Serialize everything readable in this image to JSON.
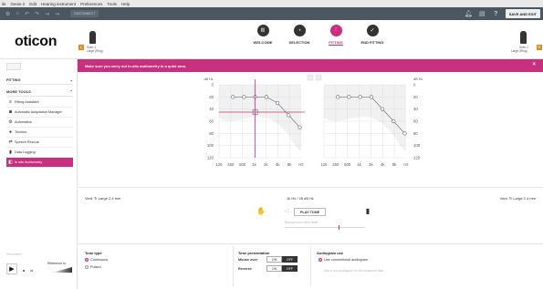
{
  "menubar": {
    "items": [
      "ile",
      "Genie 2",
      "Edit",
      "Hearing instrument",
      "Preferences",
      "Tools",
      "Help"
    ]
  },
  "toolbar": {
    "connect_label": "DISCONNECT",
    "save_exit_label": "SAVE AND EXIT"
  },
  "header": {
    "logo": "oticon",
    "device_left": {
      "tag": "L",
      "name": "Siren 1",
      "size": "Large (Ring)"
    },
    "device_right": {
      "tag": "R",
      "name": "Siren 1",
      "size": "Large (Ring)"
    },
    "nav": [
      {
        "label": "WELCOME",
        "icon": "welcome-icon"
      },
      {
        "label": "SELECTION",
        "icon": "selection-icon"
      },
      {
        "label": "FITTING",
        "icon": "fitting-icon",
        "active": true
      },
      {
        "label": "END FITTING",
        "icon": "end-fitting-icon"
      }
    ]
  },
  "sidebar": {
    "fitting_label": "FITTING",
    "more_tools_label": "MORE TOOLS",
    "items": [
      {
        "label": "Fitting Assistant",
        "icon": "fitting-assistant-icon"
      },
      {
        "label": "Automatic Adaptation Manager",
        "icon": "adaptation-manager-icon"
      },
      {
        "label": "Automatics",
        "icon": "automatics-icon"
      },
      {
        "label": "Tinnitus",
        "icon": "tinnitus-icon"
      },
      {
        "label": "Speech Rescue",
        "icon": "speech-rescue-icon"
      },
      {
        "label": "Data Logging",
        "icon": "data-logging-icon"
      },
      {
        "label": "In situ Audiometry",
        "icon": "in-situ-audiometry-icon",
        "active": true
      }
    ],
    "placeholder": "Stimulation",
    "reference_label": "Reference to"
  },
  "banner": {
    "message": "Make sure you carry out in-situ audiometry in a quiet area.",
    "close": "×"
  },
  "audiogram": {
    "unit_top": "dB HL",
    "x_ticks": [
      "125",
      "250",
      "500",
      "1k",
      "2k",
      "4k",
      "8k",
      "Hz"
    ],
    "y_ticks": [
      "0",
      "20",
      "40",
      "60",
      "80",
      "100",
      "120"
    ],
    "left_thresholds_db": [
      null,
      20,
      20,
      20,
      20,
      30,
      50,
      70,
      null
    ],
    "right_thresholds_db": [
      null,
      20,
      20,
      20,
      20,
      40,
      60,
      80,
      null
    ]
  },
  "controls": {
    "vent_left": "Vent: ↻ Large 2.4 mm",
    "vent_right": "Vent: ↻ Large 2.4 mm",
    "freq_level": "1k Hz  /  45 dB HL",
    "play_tone": "PLAY TONE",
    "background_noise": "Background noise level"
  },
  "settings": {
    "tone_type_title": "Tone type",
    "tone_continuous": "Continuous",
    "tone_pulsed": "Pulsed",
    "presentation_title": "Tone presentation",
    "mouse_over": "Mouse over",
    "reverse": "Reverse",
    "on": "ON",
    "off": "OFF",
    "audiogram_use_title": "Audiogram use",
    "use_conventional": "Use conventional audiogram",
    "conv_note": "Use in-situ audiogram for the measured data"
  },
  "colors": {
    "accent": "#c6307d",
    "toolbar": "#4a5660"
  }
}
